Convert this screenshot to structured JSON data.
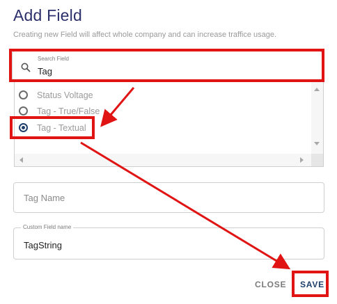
{
  "dialog": {
    "title": "Add Field",
    "subtitle": "Creating new Field will affect whole company and can increase traffice usage."
  },
  "search": {
    "label": "Search Field",
    "value": "Tag",
    "icon": "search-icon"
  },
  "options": [
    {
      "label": "Status Voltage",
      "selected": false
    },
    {
      "label": "Tag - True/False",
      "selected": false
    },
    {
      "label": "Tag - Textual",
      "selected": true
    }
  ],
  "tag_name": {
    "placeholder": "Tag Name"
  },
  "custom_field": {
    "label": "Custom Field name",
    "value": "TagString"
  },
  "buttons": {
    "close": "CLOSE",
    "save": "SAVE"
  },
  "colors": {
    "accent": "#1f3f6b",
    "title": "#2b2f6b",
    "annotation": "#e11414"
  }
}
